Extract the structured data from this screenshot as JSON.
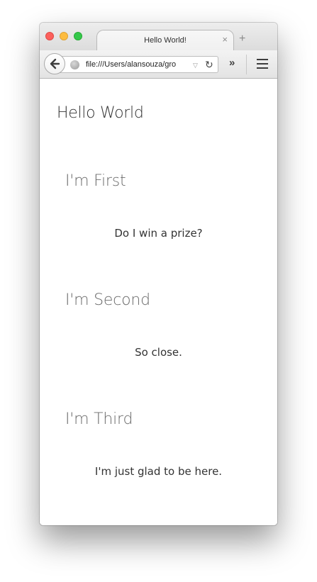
{
  "browser": {
    "tab_title": "Hello World!",
    "tab_close": "×",
    "new_tab": "+",
    "url": "file:///Users/alansouza/gro",
    "dropmarker": "▽",
    "reload": "↻",
    "overflow": "»"
  },
  "page": {
    "title": "Hello World",
    "sections": [
      {
        "heading": "I'm First",
        "body": "Do I win a prize?"
      },
      {
        "heading": "I'm Second",
        "body": "So close."
      },
      {
        "heading": "I'm Third",
        "body": "I'm just glad to be here."
      }
    ]
  },
  "colors": {
    "traffic_red": "#fc605c",
    "traffic_yellow": "#fdbc40",
    "traffic_green": "#34c84a"
  }
}
